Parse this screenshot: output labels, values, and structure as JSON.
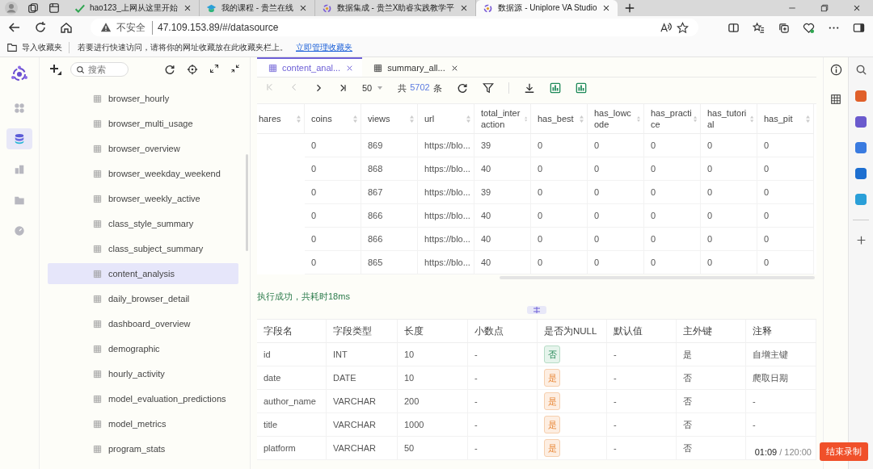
{
  "browser_tabs": [
    {
      "title": "hao123_上网从这里开始",
      "selected": false
    },
    {
      "title": "我的课程 - 贵兰在线",
      "selected": false
    },
    {
      "title": "数据集成 - 贵兰X助睿实践教学平",
      "selected": false
    },
    {
      "title": "数据源 - Uniplore VA Studio",
      "selected": true
    }
  ],
  "address_bar": {
    "security": "不安全",
    "url": "47.109.153.89/#/datasource"
  },
  "bookmarks_bar": {
    "import": "导入收藏夹",
    "message": "若要进行快速访问，请将你的网址收藏放在此收藏夹栏上。",
    "link": "立即管理收藏夹"
  },
  "nav_rail": [
    {
      "selected": false
    },
    {
      "selected": true
    },
    {
      "selected": false
    },
    {
      "selected": false
    },
    {
      "selected": false
    }
  ],
  "tree": {
    "search_placeholder": "搜索",
    "items": [
      {
        "label": "browser_hourly",
        "selected": false
      },
      {
        "label": "browser_multi_usage",
        "selected": false
      },
      {
        "label": "browser_overview",
        "selected": false
      },
      {
        "label": "browser_weekday_weekend",
        "selected": false
      },
      {
        "label": "browser_weekly_active",
        "selected": false
      },
      {
        "label": "class_style_summary",
        "selected": false
      },
      {
        "label": "class_subject_summary",
        "selected": false
      },
      {
        "label": "content_analysis",
        "selected": true
      },
      {
        "label": "daily_browser_detail",
        "selected": false
      },
      {
        "label": "dashboard_overview",
        "selected": false
      },
      {
        "label": "demographic",
        "selected": false
      },
      {
        "label": "hourly_activity",
        "selected": false
      },
      {
        "label": "model_evaluation_predictions",
        "selected": false
      },
      {
        "label": "model_metrics",
        "selected": false
      },
      {
        "label": "program_stats",
        "selected": false
      }
    ]
  },
  "doc_tabs": [
    {
      "label": "content_anal...",
      "selected": true
    },
    {
      "label": "summary_all...",
      "selected": false
    }
  ],
  "pager": {
    "page_size": "50",
    "total_prefix": "共",
    "total_count": "5702",
    "total_suffix": "条"
  },
  "grid": {
    "columns": [
      "hares",
      "coins",
      "views",
      "url",
      "total_interaction",
      "has_best",
      "has_lowcode",
      "has_practice",
      "has_tutorial",
      "has_pit"
    ],
    "rows": [
      [
        "",
        "0",
        "869",
        "https://blo...",
        "39",
        "0",
        "0",
        "0",
        "0",
        "0"
      ],
      [
        "",
        "0",
        "868",
        "https://blo...",
        "40",
        "0",
        "0",
        "0",
        "0",
        "0"
      ],
      [
        "",
        "0",
        "867",
        "https://blo...",
        "39",
        "0",
        "0",
        "0",
        "0",
        "0"
      ],
      [
        "",
        "0",
        "866",
        "https://blo...",
        "40",
        "0",
        "0",
        "0",
        "0",
        "0"
      ],
      [
        "",
        "0",
        "866",
        "https://blo...",
        "40",
        "0",
        "0",
        "0",
        "0",
        "0"
      ],
      [
        "",
        "0",
        "865",
        "https://blo...",
        "40",
        "0",
        "0",
        "0",
        "0",
        "0"
      ]
    ]
  },
  "status": "执行成功，共耗时18ms",
  "fields": {
    "columns": [
      "字段名",
      "字段类型",
      "长度",
      "小数点",
      "是否为NULL",
      "默认值",
      "主外键",
      "注释"
    ],
    "rows": [
      {
        "name": "id",
        "type": "INT",
        "length": "10",
        "scale": "-",
        "nullable": false,
        "null_text": "否",
        "default": "-",
        "key": "是",
        "comment": "自增主键"
      },
      {
        "name": "date",
        "type": "DATE",
        "length": "10",
        "scale": "-",
        "nullable": true,
        "null_text": "是",
        "default": "-",
        "key": "否",
        "comment": "爬取日期"
      },
      {
        "name": "author_name",
        "type": "VARCHAR",
        "length": "200",
        "scale": "-",
        "nullable": true,
        "null_text": "是",
        "default": "-",
        "key": "否",
        "comment": "-"
      },
      {
        "name": "title",
        "type": "VARCHAR",
        "length": "1000",
        "scale": "-",
        "nullable": true,
        "null_text": "是",
        "default": "-",
        "key": "否",
        "comment": "-"
      },
      {
        "name": "platform",
        "type": "VARCHAR",
        "length": "50",
        "scale": "-",
        "nullable": true,
        "null_text": "是",
        "default": "-",
        "key": "否",
        "comment": ""
      }
    ]
  },
  "recorder": {
    "elapsed": "01:09",
    "limit": "/ 120:00",
    "stop": "结束录制"
  }
}
